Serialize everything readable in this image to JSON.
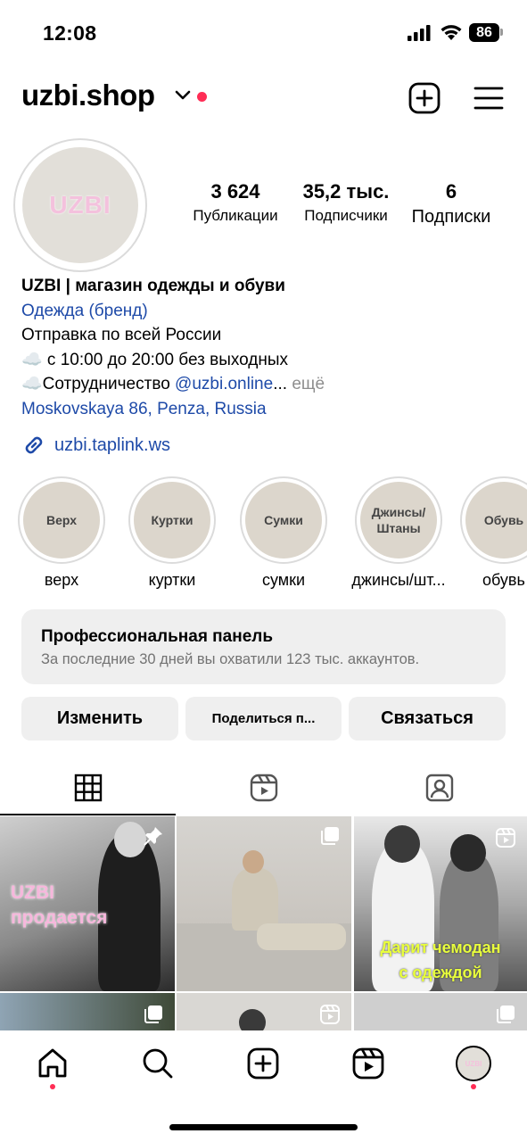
{
  "status_bar": {
    "time": "12:08",
    "battery": "86"
  },
  "header": {
    "username": "uzbi.shop"
  },
  "profile": {
    "avatar_text": "UZBI",
    "stats": [
      {
        "value": "3 624",
        "label": "Публикации"
      },
      {
        "value": "35,2 тыс.",
        "label": "Подписчики"
      },
      {
        "value": "6",
        "label": "Подписки"
      }
    ],
    "bio": {
      "name": "UZBI | магазин одежды и обуви",
      "category": "Одежда (бренд)",
      "line1": "Отправка по всей России",
      "line2": "☁️ с 10:00 до 20:00 без выходных",
      "line3_prefix": "☁️Сотрудничество ",
      "line3_mention": "@uzbi.online",
      "line3_suffix": "... ",
      "more": "ещё",
      "address": "Moskovskaya 86, Penza, Russia"
    },
    "link": "uzbi.taplink.ws"
  },
  "highlights": [
    {
      "cover": "Верх",
      "label": "верх"
    },
    {
      "cover": "Куртки",
      "label": "куртки"
    },
    {
      "cover": "Сумки",
      "label": "сумки"
    },
    {
      "cover_line1": "Джинсы/",
      "cover_line2": "Штаны",
      "label": "джинсы/шт..."
    },
    {
      "cover": "Обувь",
      "label": "обувь"
    }
  ],
  "pro_panel": {
    "title": "Профессиональная панель",
    "subtitle": "За последние 30 дней вы охватили 123 тыс. аккаунтов."
  },
  "buttons": {
    "edit": "Изменить",
    "share": "Поделиться п...",
    "contact": "Связаться"
  },
  "tabs": [
    {
      "icon": "grid-icon",
      "active": true
    },
    {
      "icon": "reels-icon",
      "active": false
    },
    {
      "icon": "tagged-icon",
      "active": false
    }
  ],
  "posts": {
    "post1_line1": "UZBI",
    "post1_line2": "продается",
    "post3_line1": "Дарит чемодан",
    "post3_line2": "с одеждой"
  },
  "colors": {
    "link_blue": "#1e4aa8",
    "notification_red": "#ff2d55",
    "button_gray": "#efefef",
    "highlight_fill": "#dcd6cc"
  }
}
